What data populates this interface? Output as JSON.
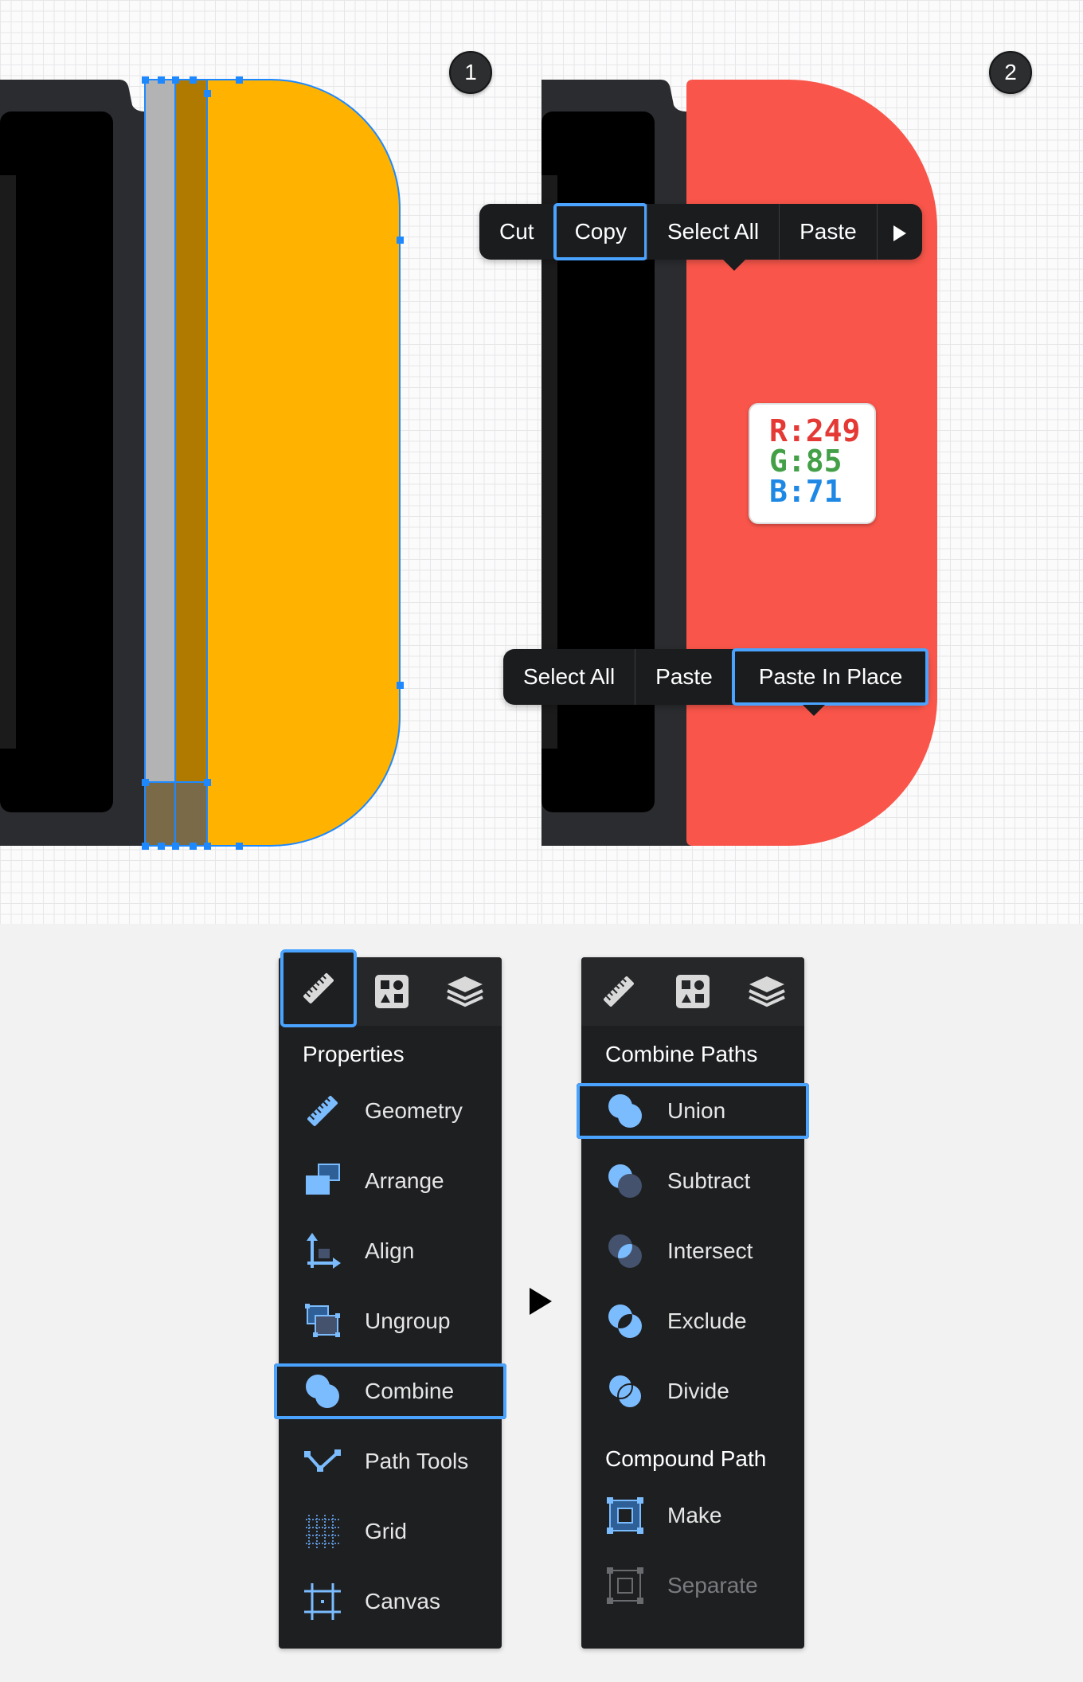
{
  "steps": [
    {
      "badge": "1"
    },
    {
      "badge": "2"
    }
  ],
  "colors": {
    "shape_step1": "#ffb300",
    "shape_step2": "#f9554a",
    "highlight": "#4aa3ff",
    "selection": "#1e88ff"
  },
  "color_sticker": {
    "r": "R:249",
    "g": "G:85",
    "b": "B:71"
  },
  "menu_top": {
    "items": [
      "Cut",
      "Copy",
      "Select All",
      "Paste"
    ],
    "selected": "Copy",
    "more_icon": "play-arrow-icon"
  },
  "menu_bottom": {
    "items": [
      "Select All",
      "Paste",
      "Paste In Place"
    ],
    "selected": "Paste In Place"
  },
  "properties_panel": {
    "tabs": [
      "ruler-icon",
      "shapes-icon",
      "layers-icon"
    ],
    "title": "Properties",
    "items": [
      "Geometry",
      "Arrange",
      "Align",
      "Ungroup",
      "Combine",
      "Path Tools",
      "Grid",
      "Canvas"
    ],
    "selected": "Combine"
  },
  "combine_panel": {
    "tabs": [
      "ruler-icon",
      "shapes-icon",
      "layers-icon"
    ],
    "title": "Combine Paths",
    "items": [
      "Union",
      "Subtract",
      "Intersect",
      "Exclude",
      "Divide"
    ],
    "selected": "Union",
    "compound_title": "Compound Path",
    "compound_items": [
      "Make",
      "Separate"
    ],
    "compound_disabled": "Separate"
  },
  "next_arrow_icon": "play-arrow-icon"
}
